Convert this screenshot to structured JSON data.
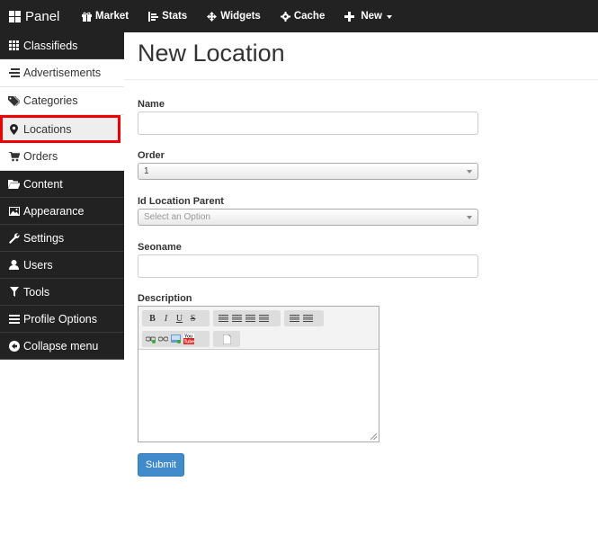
{
  "topbar": {
    "brand": "Panel",
    "items": [
      {
        "label": "Market",
        "icon": "gift-icon"
      },
      {
        "label": "Stats",
        "icon": "bar-chart-icon"
      },
      {
        "label": "Widgets",
        "icon": "move-icon"
      },
      {
        "label": "Cache",
        "icon": "gear-icon"
      },
      {
        "label": "New",
        "icon": "plus-icon"
      }
    ]
  },
  "sidebar": {
    "items": [
      {
        "label": "Classifieds",
        "icon": "grid-icon"
      },
      {
        "label": "Advertisements",
        "icon": "list-icon"
      },
      {
        "label": "Categories",
        "icon": "tags-icon"
      },
      {
        "label": "Locations",
        "icon": "map-marker-icon"
      },
      {
        "label": "Orders",
        "icon": "cart-icon"
      },
      {
        "label": "Content",
        "icon": "folder-open-icon"
      },
      {
        "label": "Appearance",
        "icon": "picture-icon"
      },
      {
        "label": "Settings",
        "icon": "wrench-icon"
      },
      {
        "label": "Users",
        "icon": "user-icon"
      },
      {
        "label": "Tools",
        "icon": "filter-icon"
      },
      {
        "label": "Profile Options",
        "icon": "list-icon"
      },
      {
        "label": "Collapse menu",
        "icon": "circle-arrow-left-icon"
      }
    ]
  },
  "page": {
    "title": "New Location"
  },
  "form": {
    "name_label": "Name",
    "name_value": "",
    "order_label": "Order",
    "order_value": "1",
    "parent_label": "Id Location Parent",
    "parent_placeholder": "Select an Option",
    "seoname_label": "Seoname",
    "seoname_value": "",
    "description_label": "Description",
    "submit_label": "Submit"
  },
  "editor": {
    "toolbar": [
      "bold",
      "italic",
      "underline",
      "strikethrough",
      "align-left",
      "align-center",
      "align-right",
      "justify",
      "bullet-list",
      "numbered-list",
      "link",
      "unlink",
      "image",
      "youtube",
      "source"
    ]
  },
  "colors": {
    "topbar": "#222222",
    "sidebar": "#222222",
    "accent": "#428bca",
    "highlight": "#ee0000"
  }
}
